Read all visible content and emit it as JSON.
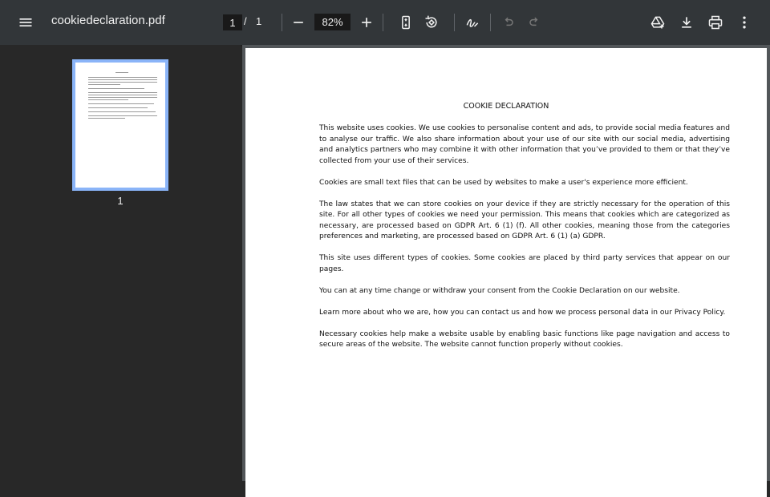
{
  "toolbar": {
    "menu_icon": "hamburger-menu-icon",
    "file_title": "cookiedeclaration.pdf",
    "current_page": "1",
    "page_separator": "/",
    "total_pages": "1",
    "zoom_level": "82%",
    "icons": [
      "minus-icon",
      "plus-icon",
      "fit-page-icon",
      "rotate-icon",
      "annotate-icon",
      "undo-icon",
      "redo-icon",
      "drive-add-icon",
      "download-icon",
      "print-icon",
      "more-vert-icon"
    ]
  },
  "sidebar": {
    "thumbnails": [
      {
        "page_label": "1"
      }
    ]
  },
  "document": {
    "heading": "COOKIE DECLARATION",
    "paragraphs": [
      "This website uses cookies. We use cookies to personalise content and ads, to provide social media features and to analyse our traffic. We also share information about your use of our site with our social media, advertising and analytics partners who may combine it with other information that you’ve provided to them or that they’ve collected from your use of their services.",
      "Cookies are small text files that can be used by websites to make a user's experience more efficient.",
      "The law states that we can store cookies on your device if they are strictly necessary for the operation of this site. For all other types of cookies we need your permission. This means that cookies which are categorized as necessary, are processed based on GDPR Art. 6 (1) (f). All other cookies, meaning those from the categories preferences and marketing, are processed based on GDPR Art. 6 (1) (a) GDPR.",
      "This site uses different types of cookies. Some cookies are placed by third party services that appear on our pages.",
      "You can at any time change or withdraw your consent from the Cookie Declaration on our website.",
      "Learn more about who we are, how you can contact us and how we process personal data in our Privacy Policy.",
      "Necessary cookies help make a website usable by enabling basic functions like page navigation and access to secure areas of the website. The website cannot function properly without cookies."
    ]
  }
}
